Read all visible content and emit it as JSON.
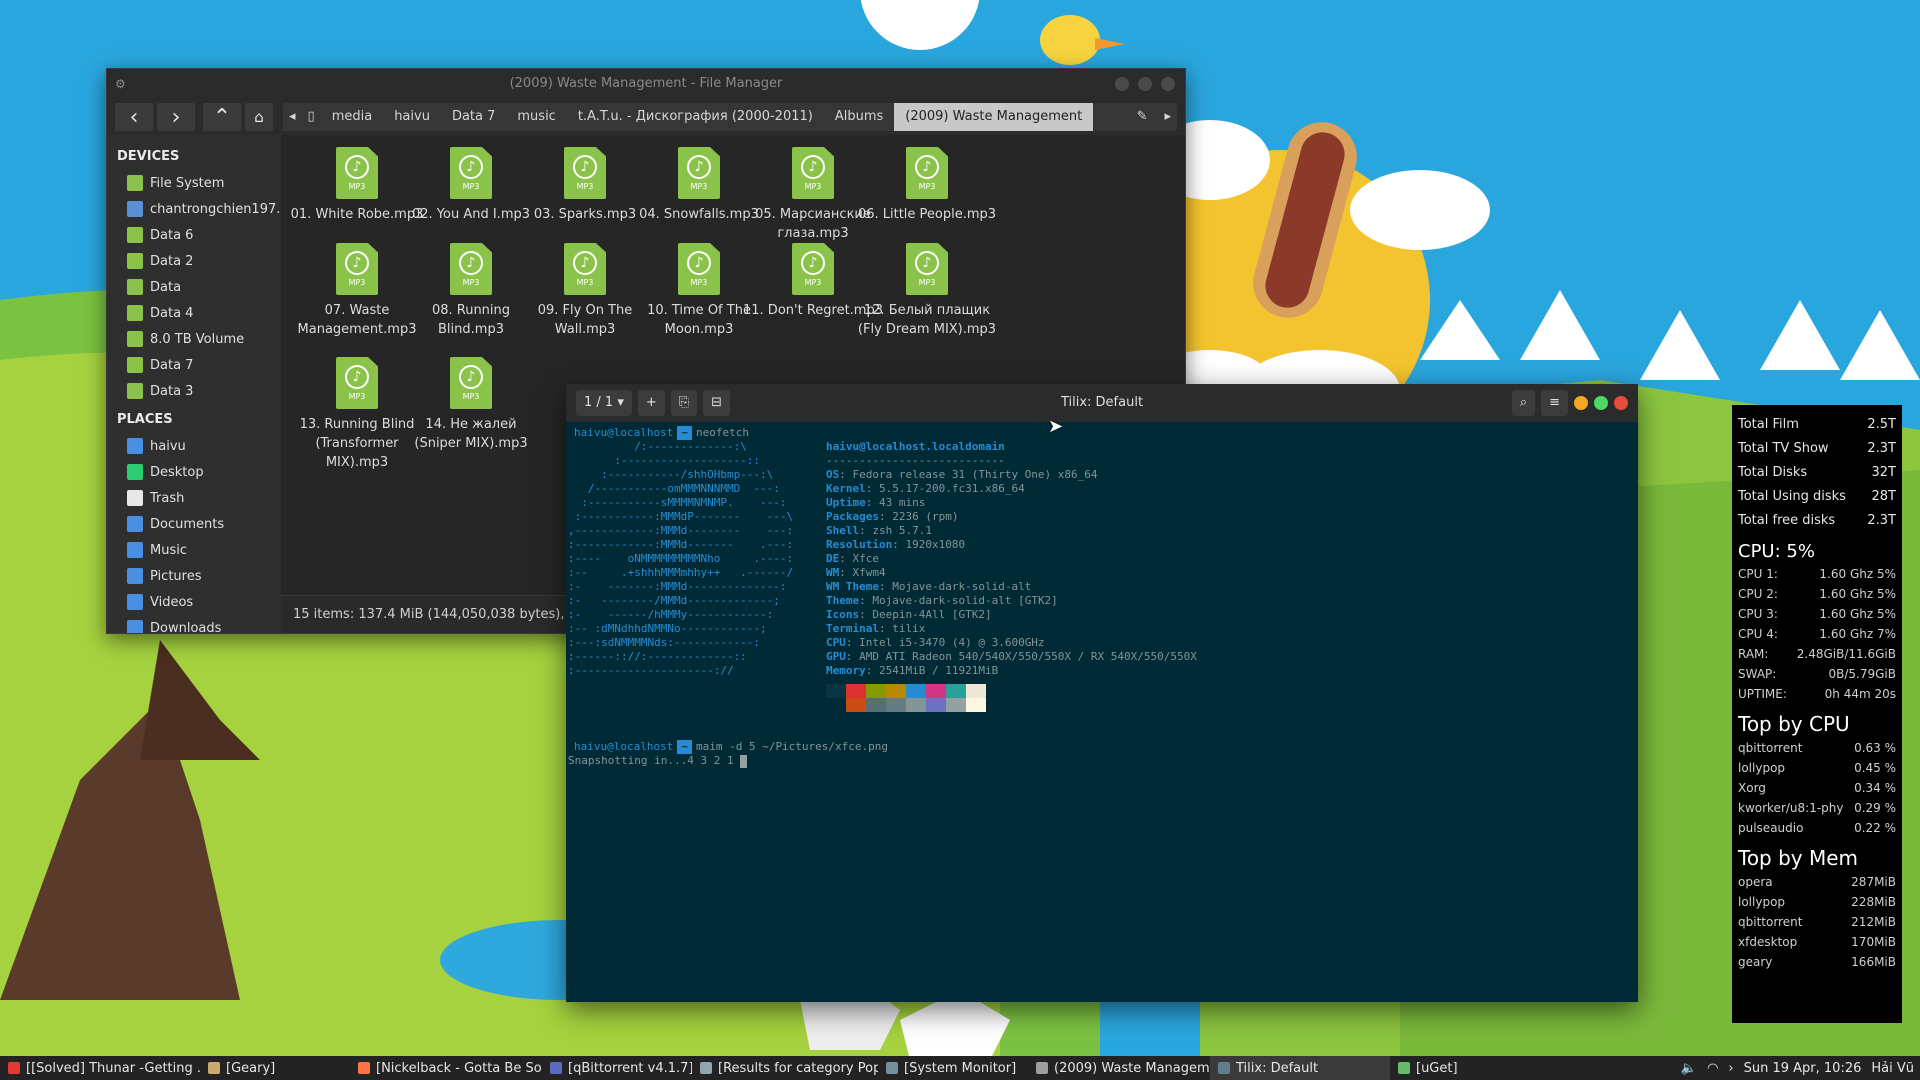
{
  "thunar": {
    "title": "(2009) Waste Management - File Manager",
    "breadcrumbs": [
      "media",
      "haivu",
      "Data 7",
      "music",
      "t.A.T.u. - Дискография (2000-2011)",
      "Albums",
      "(2009) Waste Management"
    ],
    "devices_header": "DEVICES",
    "devices": [
      {
        "label": "File System",
        "icon": "drive-icon",
        "color": "#8bc34a"
      },
      {
        "label": "chantrongchien197...",
        "icon": "network-drive-icon",
        "color": "#5b8fd6"
      },
      {
        "label": "Data 6",
        "icon": "usb-drive-icon",
        "color": "#8bc34a"
      },
      {
        "label": "Data 2",
        "icon": "usb-drive-icon",
        "color": "#8bc34a"
      },
      {
        "label": "Data",
        "icon": "usb-drive-icon",
        "color": "#8bc34a"
      },
      {
        "label": "Data 4",
        "icon": "usb-drive-icon",
        "color": "#8bc34a"
      },
      {
        "label": "8.0 TB Volume",
        "icon": "usb-drive-icon",
        "color": "#8bc34a"
      },
      {
        "label": "Data 7",
        "icon": "drive-icon",
        "color": "#8bc34a"
      },
      {
        "label": "Data 3",
        "icon": "drive-icon",
        "color": "#8bc34a"
      }
    ],
    "places_header": "PLACES",
    "places": [
      {
        "label": "haivu",
        "icon": "home-icon",
        "color": "#4a90e2"
      },
      {
        "label": "Desktop",
        "icon": "desktop-icon",
        "color": "#2ecc71"
      },
      {
        "label": "Trash",
        "icon": "trash-icon",
        "color": "#e8e8e8"
      },
      {
        "label": "Documents",
        "icon": "folder-icon",
        "color": "#4a90e2"
      },
      {
        "label": "Music",
        "icon": "folder-icon",
        "color": "#4a90e2"
      },
      {
        "label": "Pictures",
        "icon": "folder-icon",
        "color": "#4a90e2"
      },
      {
        "label": "Videos",
        "icon": "folder-icon",
        "color": "#4a90e2"
      },
      {
        "label": "Downloads",
        "icon": "folder-icon",
        "color": "#4a90e2"
      }
    ],
    "file_tag": "MP3",
    "files": [
      "01. White Robe.mp3",
      "02. You And I.mp3",
      "03. Sparks.mp3",
      "04. Snowfalls.mp3",
      "05. Марсианские глаза.mp3",
      "06. Little People.mp3",
      "07. Waste Management.mp3",
      "08. Running Blind.mp3",
      "09. Fly On The Wall.mp3",
      "10. Time Of The Moon.mp3",
      "11. Don't Regret.mp3",
      "12. Белый плащик (Fly Dream MIX).mp3",
      "13. Running Blind (Transformer MIX).mp3",
      "14. Не жалей (Sniper MIX).mp3"
    ],
    "status": "15 items: 137.4 MiB (144,050,038 bytes), Free"
  },
  "tilix": {
    "title": "Tilix: Default",
    "tab_counter": "1 / 1",
    "prompt_user": "haivu@localhost",
    "prompt_dir": "~",
    "cmd1": "neofetch",
    "cmd2": "maim -d 5 ~/Pictures/xfce.png",
    "output": "Snapshotting in...4 3 2 1",
    "neofetch_header": "haivu@localhost.localdomain",
    "neofetch_sep": "---------------------------",
    "info": [
      {
        "k": "OS",
        "v": "Fedora release 31 (Thirty One) x86_64"
      },
      {
        "k": "Kernel",
        "v": "5.5.17-200.fc31.x86_64"
      },
      {
        "k": "Uptime",
        "v": "43 mins"
      },
      {
        "k": "Packages",
        "v": "2236 (rpm)"
      },
      {
        "k": "Shell",
        "v": "zsh 5.7.1"
      },
      {
        "k": "Resolution",
        "v": "1920x1080"
      },
      {
        "k": "DE",
        "v": "Xfce"
      },
      {
        "k": "WM",
        "v": "Xfwm4"
      },
      {
        "k": "WM Theme",
        "v": "Mojave-dark-solid-alt"
      },
      {
        "k": "Theme",
        "v": "Mojave-dark-solid-alt [GTK2]"
      },
      {
        "k": "Icons",
        "v": "Deepin-4All [GTK2]"
      },
      {
        "k": "Terminal",
        "v": "tilix"
      },
      {
        "k": "CPU",
        "v": "Intel i5-3470 (4) @ 3.600GHz"
      },
      {
        "k": "GPU",
        "v": "AMD ATI Radeon 540/540X/550/550X / RX 540X/550/550X"
      },
      {
        "k": "Memory",
        "v": "2541MiB / 11921MiB"
      }
    ],
    "ascii_art": "          /:-------------:\\\n       :-------------------::\n     :-----------/shhOHbmp---:\\\n   /-----------omMMMNNNMMD  ---:\n  :-----------sMMMMNMNMP.    ---:\n :-----------:MMMdP-------    ---\\\n,------------:MMMd--------    ---:\n:------------:MMMd-------    .---:\n:----    oNMMMMMMMMMNho     .----:\n:--     .+shhhMMMmhhy++   .------/\n:-    -------:MMMd--------------:\n:-   --------/MMMd-------------;\n:-    ------/hMMMy------------:\n:-- :dMNdhhdNMMNo------------;\n:---:sdNMMMMNds:------------:\n:------:://:-------------::\n:---------------------://",
    "swatch_colors": [
      "#073642",
      "#dc322f",
      "#859900",
      "#b58900",
      "#268bd2",
      "#d33682",
      "#2aa198",
      "#eee8d5",
      "#002b36",
      "#cb4b16",
      "#586e75",
      "#657b83",
      "#839496",
      "#6c71c4",
      "#93a1a1",
      "#fdf6e3"
    ]
  },
  "conky": {
    "totals": [
      {
        "k": "Total Film",
        "v": "2.5T"
      },
      {
        "k": "Total TV Show",
        "v": "2.3T"
      },
      {
        "k": "Total Disks",
        "v": "32T"
      },
      {
        "k": "Total Using disks",
        "v": "28T"
      },
      {
        "k": "Total free disks",
        "v": "2.3T"
      }
    ],
    "cpu_header": "CPU: 5%",
    "cpus": [
      {
        "k": "CPU 1:",
        "v": "1.60 Ghz 5%"
      },
      {
        "k": "CPU 2:",
        "v": "1.60 Ghz 5%"
      },
      {
        "k": "CPU 3:",
        "v": "1.60 Ghz 5%"
      },
      {
        "k": "CPU 4:",
        "v": "1.60 Ghz 7%"
      },
      {
        "k": "RAM:",
        "v": "2.48GiB/11.6GiB"
      },
      {
        "k": "SWAP:",
        "v": "0B/5.79GiB"
      },
      {
        "k": "UPTIME:",
        "v": "0h 44m 20s"
      }
    ],
    "top_cpu_header": "Top by CPU",
    "top_cpu": [
      {
        "k": "qbittorrent",
        "v": "0.63 %"
      },
      {
        "k": "lollypop",
        "v": "0.45 %"
      },
      {
        "k": "Xorg",
        "v": "0.34 %"
      },
      {
        "k": "kworker/u8:1-phy",
        "v": "0.29 %"
      },
      {
        "k": "pulseaudio",
        "v": "0.22 %"
      }
    ],
    "top_mem_header": "Top by Mem",
    "top_mem": [
      {
        "k": "opera",
        "v": "287MiB"
      },
      {
        "k": "lollypop",
        "v": "228MiB"
      },
      {
        "k": "qbittorrent",
        "v": "212MiB"
      },
      {
        "k": "xfdesktop",
        "v": "170MiB"
      },
      {
        "k": "geary",
        "v": "166MiB"
      }
    ]
  },
  "taskbar": {
    "tasks": [
      {
        "label": "[[Solved] Thunar -Getting ...",
        "icon": "opera-icon",
        "color": "#e53935",
        "active": false
      },
      {
        "label": "[Geary]",
        "icon": "geary-icon",
        "color": "#c9a96e",
        "active": false
      },
      {
        "label": "[Nickelback - Gotta Be So...",
        "icon": "lollypop-icon",
        "color": "#ff7043",
        "active": false
      },
      {
        "label": "[qBittorrent v4.1.7]",
        "icon": "qbittorrent-icon",
        "color": "#5c6bc0",
        "active": false
      },
      {
        "label": "[Results for category Pop...",
        "icon": "music-icon",
        "color": "#90a4ae",
        "active": false
      },
      {
        "label": "[System Monitor]",
        "icon": "monitor-icon",
        "color": "#78909c",
        "active": false
      },
      {
        "label": "(2009) Waste Managemen...",
        "icon": "folder-icon",
        "color": "#9e9e9e",
        "active": false
      },
      {
        "label": "Tilix: Default",
        "icon": "terminal-icon",
        "color": "#607d8b",
        "active": true
      },
      {
        "label": "[uGet]",
        "icon": "uget-icon",
        "color": "#66bb6a",
        "active": false
      }
    ],
    "clock": "Sun 19 Apr, 10:26",
    "user": "Hải Vũ"
  }
}
